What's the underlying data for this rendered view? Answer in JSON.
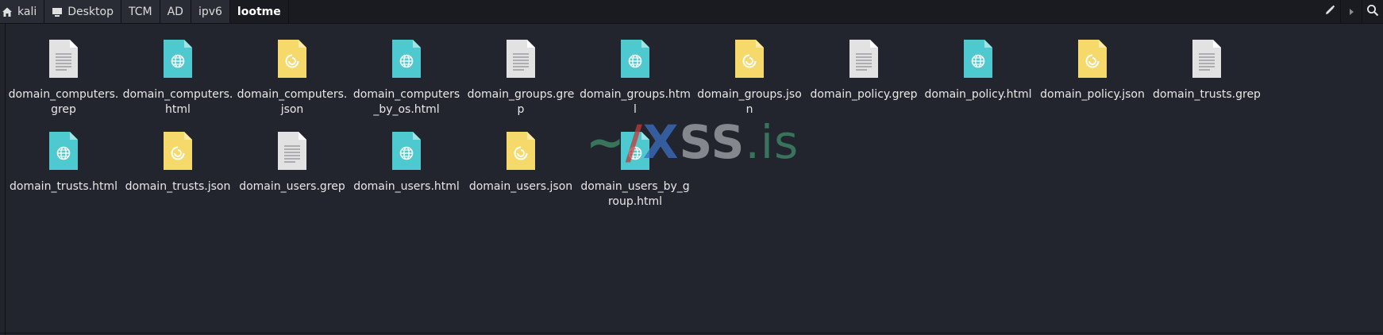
{
  "breadcrumbs": [
    {
      "label": "kali",
      "icon": "home-icon"
    },
    {
      "label": "Desktop",
      "icon": "desktop-icon"
    },
    {
      "label": "TCM"
    },
    {
      "label": "AD"
    },
    {
      "label": "ipv6"
    },
    {
      "label": "lootme",
      "active": true
    }
  ],
  "toolbar": {
    "edit_icon": "pencil-icon",
    "forward_icon": "chevron-right-icon",
    "search_icon": "search-icon"
  },
  "files": [
    {
      "name": "domain_computers.grep",
      "type": "text"
    },
    {
      "name": "domain_computers.html",
      "type": "html"
    },
    {
      "name": "domain_computers.json",
      "type": "json"
    },
    {
      "name": "domain_computers_by_os.html",
      "type": "html"
    },
    {
      "name": "domain_groups.grep",
      "type": "text"
    },
    {
      "name": "domain_groups.html",
      "type": "html"
    },
    {
      "name": "domain_groups.json",
      "type": "json"
    },
    {
      "name": "domain_policy.grep",
      "type": "text"
    },
    {
      "name": "domain_policy.html",
      "type": "html"
    },
    {
      "name": "domain_policy.json",
      "type": "json"
    },
    {
      "name": "domain_trusts.grep",
      "type": "text"
    },
    {
      "name": "domain_trusts.html",
      "type": "html"
    },
    {
      "name": "domain_trusts.json",
      "type": "json"
    },
    {
      "name": "domain_users.grep",
      "type": "text"
    },
    {
      "name": "domain_users.html",
      "type": "html"
    },
    {
      "name": "domain_users.json",
      "type": "json"
    },
    {
      "name": "domain_users_by_group.html",
      "type": "html"
    }
  ],
  "watermark": {
    "tilde": "~",
    "slash": "/",
    "x": "X",
    "ss": "SS",
    "is": ".is"
  },
  "colors": {
    "html_icon": "#4ec9cf",
    "json_icon": "#f5d96b",
    "text_icon": "#e2e2e2",
    "background": "#23252e"
  }
}
